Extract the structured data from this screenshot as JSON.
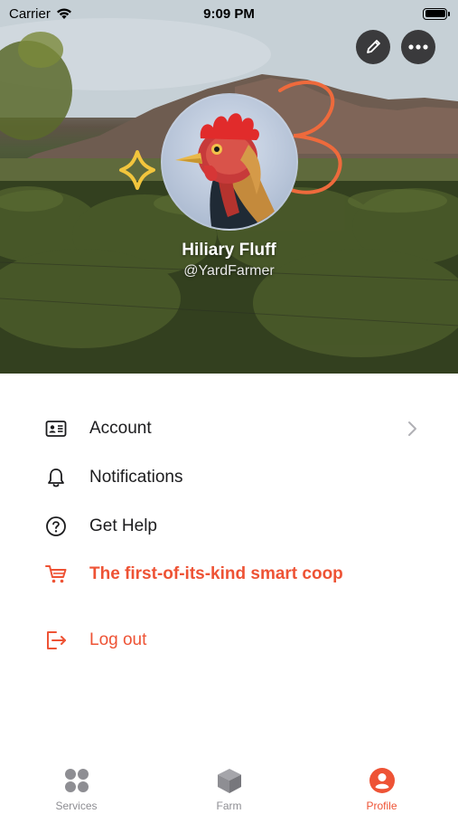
{
  "status_bar": {
    "carrier": "Carrier",
    "time": "9:09 PM"
  },
  "hero": {
    "actions": [
      {
        "icon": "pencil-icon"
      },
      {
        "icon": "ellipsis-icon"
      }
    ]
  },
  "profile": {
    "name": "Hiliary Fluff",
    "handle": "@YardFarmer"
  },
  "menu": {
    "items": [
      {
        "label": "Account",
        "icon": "id-card-icon",
        "has_chevron": true
      },
      {
        "label": "Notifications",
        "icon": "bell-icon"
      },
      {
        "label": "Get Help",
        "icon": "question-circle-icon"
      },
      {
        "label": "The first-of-its-kind smart coop",
        "icon": "cart-icon"
      },
      {
        "label": "Log out",
        "icon": "logout-icon"
      }
    ]
  },
  "tabbar": {
    "tabs": [
      {
        "label": "Services",
        "icon": "grid-dots-icon"
      },
      {
        "label": "Farm",
        "icon": "cube-icon"
      },
      {
        "label": "Profile",
        "icon": "person-circle-icon",
        "active": true
      }
    ]
  },
  "colors": {
    "accent": "#ee5335",
    "inactive": "#8e8e93",
    "text": "#1c1c1e"
  }
}
